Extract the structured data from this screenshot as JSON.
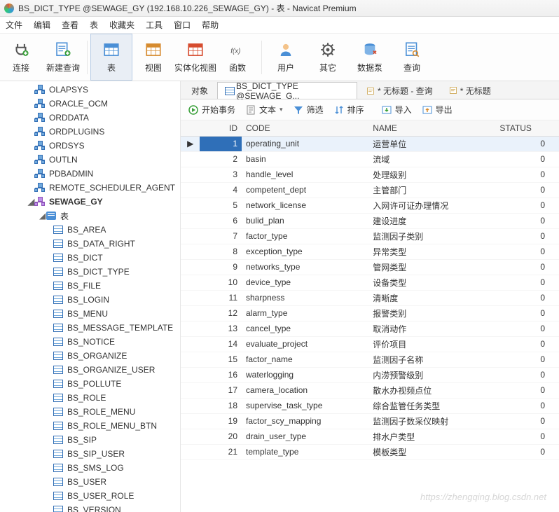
{
  "window": {
    "title": "BS_DICT_TYPE @SEWAGE_GY (192.168.10.226_SEWAGE_GY) - 表 - Navicat Premium"
  },
  "menubar": [
    "文件",
    "编辑",
    "查看",
    "表",
    "收藏夹",
    "工具",
    "窗口",
    "帮助"
  ],
  "toolbar": [
    {
      "label": "连接",
      "icon": "plug"
    },
    {
      "label": "新建查询",
      "icon": "newquery"
    },
    {
      "label": "表",
      "icon": "table",
      "active": true
    },
    {
      "label": "视图",
      "icon": "view"
    },
    {
      "label": "实体化视图",
      "icon": "matview"
    },
    {
      "label": "函数",
      "icon": "fx"
    },
    {
      "label": "用户",
      "icon": "user"
    },
    {
      "label": "其它",
      "icon": "gear"
    },
    {
      "label": "数据泵",
      "icon": "pump"
    },
    {
      "label": "查询",
      "icon": "query"
    }
  ],
  "tree": {
    "schemas": [
      "OLAPSYS",
      "ORACLE_OCM",
      "ORDDATA",
      "ORDPLUGINS",
      "ORDSYS",
      "OUTLN",
      "PDBADMIN",
      "REMOTE_SCHEDULER_AGENT"
    ],
    "active_schema": "SEWAGE_GY",
    "tables_label": "表",
    "tables": [
      "BS_AREA",
      "BS_DATA_RIGHT",
      "BS_DICT",
      "BS_DICT_TYPE",
      "BS_FILE",
      "BS_LOGIN",
      "BS_MENU",
      "BS_MESSAGE_TEMPLATE",
      "BS_NOTICE",
      "BS_ORGANIZE",
      "BS_ORGANIZE_USER",
      "BS_POLLUTE",
      "BS_ROLE",
      "BS_ROLE_MENU",
      "BS_ROLE_MENU_BTN",
      "BS_SIP",
      "BS_SIP_USER",
      "BS_SMS_LOG",
      "BS_USER",
      "BS_USER_ROLE",
      "BS_VERSION"
    ]
  },
  "tabs": {
    "object": "对象",
    "active": "BS_DICT_TYPE @SEWAGE_G...",
    "untitled": "* 无标题 - 查询",
    "untitled2": "* 无标题"
  },
  "subtoolbar": {
    "begin": "开始事务",
    "text": "文本",
    "filter": "筛选",
    "sort": "排序",
    "import": "导入",
    "export": "导出"
  },
  "columns": {
    "id": "ID",
    "code": "CODE",
    "name": "NAME",
    "status": "STATUS"
  },
  "rows": [
    {
      "id": 1,
      "code": "operating_unit",
      "name": "运营单位",
      "status": 0,
      "sel": true
    },
    {
      "id": 2,
      "code": "basin",
      "name": "流域",
      "status": 0
    },
    {
      "id": 3,
      "code": "handle_level",
      "name": "处理级别",
      "status": 0
    },
    {
      "id": 4,
      "code": "competent_dept",
      "name": "主管部门",
      "status": 0
    },
    {
      "id": 5,
      "code": "network_license",
      "name": "入网许可证办理情况",
      "status": 0
    },
    {
      "id": 6,
      "code": "bulid_plan",
      "name": "建设进度",
      "status": 0
    },
    {
      "id": 7,
      "code": "factor_type",
      "name": "监测因子类别",
      "status": 0
    },
    {
      "id": 8,
      "code": "exception_type",
      "name": "异常类型",
      "status": 0
    },
    {
      "id": 9,
      "code": "networks_type",
      "name": "管网类型",
      "status": 0
    },
    {
      "id": 10,
      "code": "device_type",
      "name": "设备类型",
      "status": 0
    },
    {
      "id": 11,
      "code": "sharpness",
      "name": "清晰度",
      "status": 0
    },
    {
      "id": 12,
      "code": "alarm_type",
      "name": "报警类别",
      "status": 0
    },
    {
      "id": 13,
      "code": "cancel_type",
      "name": "取消动作",
      "status": 0
    },
    {
      "id": 14,
      "code": "evaluate_project",
      "name": "评价项目",
      "status": 0
    },
    {
      "id": 15,
      "code": "factor_name",
      "name": "监测因子名称",
      "status": 0
    },
    {
      "id": 16,
      "code": "waterlogging",
      "name": "内涝预警级别",
      "status": 0
    },
    {
      "id": 17,
      "code": "camera_location",
      "name": "散水办视频点位",
      "status": 0
    },
    {
      "id": 18,
      "code": "supervise_task_type",
      "name": "综合监管任务类型",
      "status": 0
    },
    {
      "id": 19,
      "code": "factor_scy_mapping",
      "name": "监测因子数采仪映射",
      "status": 0
    },
    {
      "id": 20,
      "code": "drain_user_type",
      "name": "排水户类型",
      "status": 0
    },
    {
      "id": 21,
      "code": "template_type",
      "name": "模板类型",
      "status": 0
    }
  ],
  "watermark": "https://zhengqing.blog.csdn.net"
}
